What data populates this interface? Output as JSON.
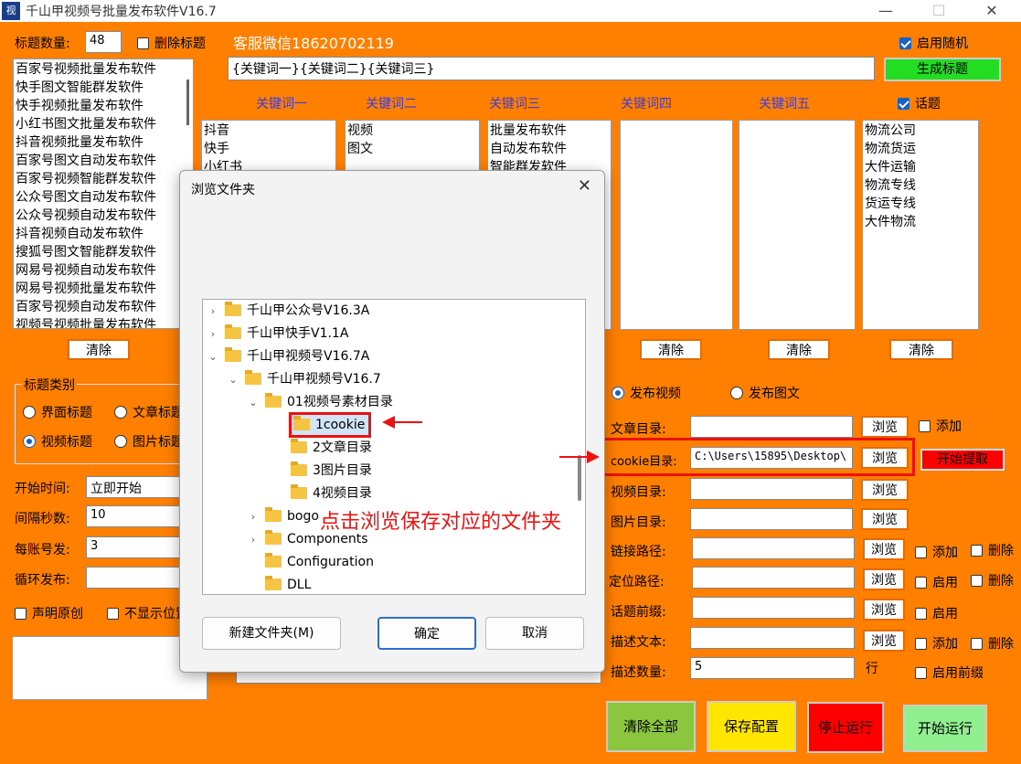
{
  "window": {
    "icon_text": "视",
    "title": "千山甲视频号批量发布软件V16.7",
    "minimize": "—",
    "maximize": "☐",
    "close": "✕"
  },
  "top": {
    "title_count_label": "标题数量:",
    "title_count_value": "48",
    "delete_title_label": "删除标题",
    "service_label": "客服微信18620702119",
    "enable_random_label": "启用随机",
    "template_value": "{关键词一}{关键词二}{关键词三}",
    "generate_button": "生成标题"
  },
  "title_list": [
    "百家号视频批量发布软件",
    "快手图文智能群发软件",
    "快手视频批量发布软件",
    "小红书图文批量发布软件",
    "抖音视频批量发布软件",
    "百家号图文自动发布软件",
    "百家号视频智能群发软件",
    "公众号图文自动发布软件",
    "公众号视频自动发布软件",
    "抖音视频自动发布软件",
    "搜狐号图文智能群发软件",
    "网易号视频自动发布软件",
    "网易号视频批量发布软件",
    "百家号视频自动发布软件",
    "视频号视频批量发布软件"
  ],
  "keywords": {
    "headers": [
      "关键词一",
      "关键词二",
      "关键词三",
      "关键词四",
      "关键词五"
    ],
    "topic_label": "话题",
    "kw1": [
      "抖音",
      "快手",
      "小红书"
    ],
    "kw2": [
      "视频",
      "图文"
    ],
    "kw3": [
      "批量发布软件",
      "自动发布软件",
      "智能群发软件"
    ],
    "topics": [
      "物流公司",
      "物流货运",
      "大件运输",
      "物流专线",
      "货运专线",
      "大件物流"
    ]
  },
  "clear_label": "清除",
  "category": {
    "group_label": "标题类别",
    "opt_interface": "界面标题",
    "opt_article": "文章标题",
    "opt_video": "视频标题",
    "opt_image": "图片标题"
  },
  "settings": {
    "start_label": "开始时间:",
    "start_value": "立即开始",
    "interval_label": "间隔秒数:",
    "interval_value": "10",
    "per_account_label": "每账号发:",
    "per_account_value": "3",
    "loop_label": "循环发布:",
    "loop_value": "",
    "original_label": "声明原创",
    "hide_label": "不显示位置"
  },
  "publish": {
    "video_label": "发布视频",
    "image_label": "发布图文"
  },
  "dirs": {
    "article_label": "文章目录:",
    "cookie_label": "cookie目录:",
    "cookie_value": "C:\\Users\\15895\\Desktop\\",
    "video_label": "视频目录:",
    "image_label": "图片目录:",
    "link_label": "链接路径:",
    "location_label": "定位路径:",
    "topic_prefix_label": "话题前缀:",
    "desc_text_label": "描述文本:",
    "desc_count_label": "描述数量:",
    "desc_count_value": "5",
    "row_unit": "行",
    "browse": "浏览",
    "add": "添加",
    "delete": "删除",
    "enable": "启用",
    "enable_prefix": "启用前缀",
    "start_extract": "开始提取"
  },
  "actions": {
    "clear_all": "清除全部",
    "save_config": "保存配置",
    "stop": "停止运行",
    "start": "开始运行"
  },
  "dialog": {
    "title": "浏览文件夹",
    "close": "✕",
    "tree": [
      {
        "label": "千山甲公众号V16.3A",
        "expander": "›"
      },
      {
        "label": "千山甲快手V1.1A",
        "expander": "›"
      },
      {
        "label": "千山甲视频号V16.7A",
        "expander": "⌄"
      },
      {
        "label": "千山甲视频号V16.7",
        "expander": "⌄"
      },
      {
        "label": "01视频号素材目录",
        "expander": "⌄"
      },
      {
        "label": "1cookie",
        "expander": ""
      },
      {
        "label": "2文章目录",
        "expander": ""
      },
      {
        "label": "3图片目录",
        "expander": ""
      },
      {
        "label": "4视频目录",
        "expander": ""
      },
      {
        "label": "bogo",
        "expander": "›"
      },
      {
        "label": "Components",
        "expander": "›"
      },
      {
        "label": "Configuration",
        "expander": ""
      },
      {
        "label": "DLL",
        "expander": ""
      }
    ],
    "new_folder": "新建文件夹(M)",
    "ok": "确定",
    "cancel": "取消"
  },
  "annotation": "点击浏览保存对应的文件夹",
  "colors": {
    "background": "#ff7f00",
    "generate": "#22dd22",
    "start_extract": "#ff0000",
    "clear_all": "#8cc63f",
    "save": "#ffe600",
    "stop": "#ff0000",
    "start": "#90f090",
    "annotation": "#ee1111"
  }
}
